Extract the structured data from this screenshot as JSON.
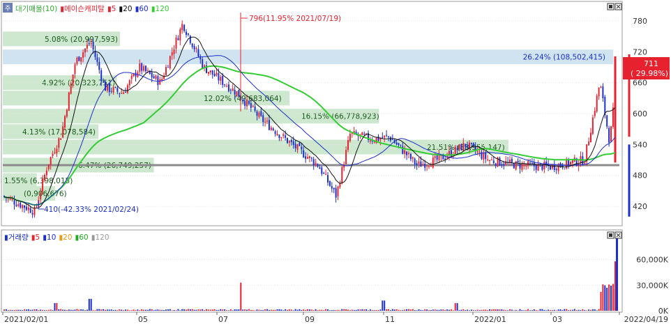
{
  "colors": {
    "up": "#e8212e",
    "down": "#1c2fcf",
    "ma5": "#111111",
    "ma20": "#1c2fcf",
    "ma120": "#33cc33",
    "profile": "#cde8cf",
    "profile_hi": "#cfe4f0",
    "volume_pane_bg": "#ffffff",
    "pane_border": "#999999",
    "current_price_bg": "#e8212e"
  },
  "main_pane": {
    "legend": {
      "icon": "chart-icon",
      "items": [
        {
          "text": "대기매물(10)",
          "color": "#33aa33"
        },
        {
          "text": "메이슨캐피탈",
          "color": "#e8212e",
          "marker": "▮"
        },
        {
          "text": "5",
          "color": "#e8212e",
          "marker": "▮"
        },
        {
          "text": "20",
          "color": "#111111",
          "marker": "▮"
        },
        {
          "text": "60",
          "color": "#1c2fcf",
          "marker": "▮"
        },
        {
          "text": "120",
          "color": "#33cc33",
          "marker": "▮"
        }
      ]
    },
    "window_buttons": [
      "restore-icon",
      "close-icon"
    ],
    "annotations": {
      "high": "796(11.95% 2021/07/19)",
      "low": "410(-42.33% 2021/02/24)"
    },
    "current_price": {
      "price": "711",
      "pct": "( 29.98%)"
    }
  },
  "volume_pane": {
    "legend": {
      "items": [
        {
          "text": "거래량",
          "color": "#1c2fcf",
          "marker": "▮"
        },
        {
          "text": "5",
          "color": "#e8212e",
          "marker": "▮"
        },
        {
          "text": "10",
          "color": "#1c2fcf",
          "marker": "▮"
        },
        {
          "text": "20",
          "color": "#e89a1a",
          "marker": "▮"
        },
        {
          "text": "60",
          "color": "#22aa22",
          "marker": "▮"
        },
        {
          "text": "120",
          "color": "#999999",
          "marker": "▮"
        }
      ]
    },
    "window_buttons": [
      "restore-icon",
      "close-icon"
    ]
  },
  "chart_data": [
    {
      "type": "candlestick",
      "title": "메이슨캐피탈",
      "x_range": [
        "2021/02/01",
        "2022/04/19"
      ],
      "x_ticks": [
        "2021/02/01",
        "05",
        "07",
        "09",
        "11",
        "2022/01",
        "03",
        "2022/04/19"
      ],
      "y_ticks": [
        420,
        480,
        540,
        600,
        660,
        720,
        780
      ],
      "ylim": [
        385,
        815
      ],
      "reference_line": 500,
      "price_path": [
        [
          "2021/02/01",
          440
        ],
        [
          "2021/02/24",
          410
        ],
        [
          "2021/03/05",
          500
        ],
        [
          "2021/03/15",
          560
        ],
        [
          "2021/03/25",
          700
        ],
        [
          "2021/04/05",
          740
        ],
        [
          "2021/04/15",
          650
        ],
        [
          "2021/04/28",
          640
        ],
        [
          "2021/05/10",
          690
        ],
        [
          "2021/05/25",
          660
        ],
        [
          "2021/06/10",
          775
        ],
        [
          "2021/06/25",
          690
        ],
        [
          "2021/07/19",
          640
        ],
        [
          "2021/08/05",
          590
        ],
        [
          "2021/08/25",
          545
        ],
        [
          "2021/09/15",
          500
        ],
        [
          "2021/09/28",
          440
        ],
        [
          "2021/10/08",
          560
        ],
        [
          "2021/10/25",
          550
        ],
        [
          "2021/11/05",
          555
        ],
        [
          "2021/11/25",
          500
        ],
        [
          "2021/12/10",
          510
        ],
        [
          "2021/12/30",
          540
        ],
        [
          "2022/01/15",
          510
        ],
        [
          "2022/02/05",
          500
        ],
        [
          "2022/03/01",
          497
        ],
        [
          "2022/03/25",
          510
        ],
        [
          "2022/04/05",
          660
        ],
        [
          "2022/04/12",
          545
        ],
        [
          "2022/04/19",
          711
        ]
      ],
      "volume_profile": [
        {
          "label": "1.55% (6,398,015)"
        },
        {
          "label": "6.47% (26,749,257)"
        },
        {
          "label": "21.51% (88,955,147)"
        },
        {
          "label": "4.13% (17,078,584)"
        },
        {
          "label": "16.15% (66,778,923)"
        },
        {
          "label": "12.02% (49,683,064)"
        },
        {
          "label": "4.92% (20,323,751)"
        },
        {
          "label": "26.24% (108,502,415)"
        },
        {
          "label": "5.08% (20,997,593)"
        },
        {
          "label": "(0,906,676)"
        }
      ]
    },
    {
      "type": "bar",
      "title": "거래량",
      "y_ticks": [
        "0K",
        "30,000K",
        "60,000K"
      ],
      "ylim": [
        0,
        90000
      ]
    }
  ],
  "x_tick_labels": [
    "2021/02/01",
    "05",
    "07",
    "09",
    "11",
    "2022/01",
    "03",
    "2022/04/19"
  ],
  "price_tick_labels": [
    "780",
    "720",
    "660",
    "600",
    "540",
    "480",
    "420"
  ],
  "volume_tick_labels": [
    "60,000K",
    "30,000K",
    "0K"
  ]
}
